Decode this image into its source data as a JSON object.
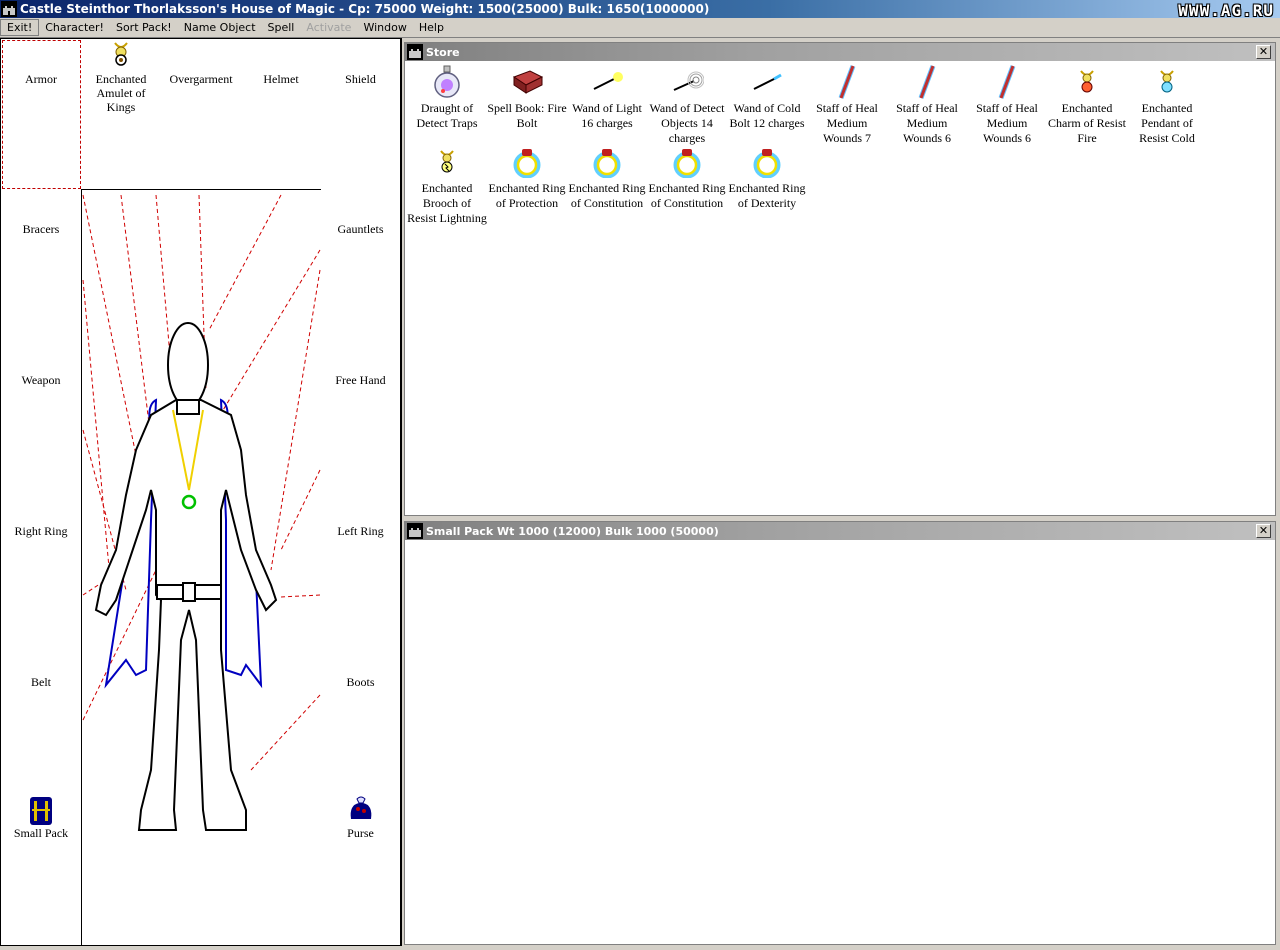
{
  "window": {
    "title": "Castle Steinthor Thorlaksson's House of Magic - Cp: 75000 Weight: 1500(25000) Bulk: 1650(1000000)",
    "watermark": "WWW.AG.RU",
    "app_icon": "castle-icon"
  },
  "menu": {
    "items": [
      "Exit!",
      "Character!",
      "Sort Pack!",
      "Name Object",
      "Spell",
      "Activate",
      "Window",
      "Help"
    ],
    "active_index": 0,
    "disabled_index": 5
  },
  "equipment": {
    "armor": "Armor",
    "amulet": "Enchanted Amulet of Kings",
    "overgarment": "Overgarment",
    "helmet": "Helmet",
    "shield": "Shield",
    "bracers": "Bracers",
    "gauntlets": "Gauntlets",
    "weapon": "Weapon",
    "free_hand": "Free Hand",
    "right_ring": "Right Ring",
    "left_ring": "Left Ring",
    "belt": "Belt",
    "boots": "Boots",
    "small_pack": "Small Pack",
    "purse": "Purse"
  },
  "store": {
    "title": "Store",
    "close": "✕",
    "items": [
      {
        "label": "Draught of Detect Traps",
        "icon": "potion-icon"
      },
      {
        "label": "Spell Book: Fire Bolt",
        "icon": "spellbook-icon"
      },
      {
        "label": "Wand of Light 16 charges",
        "icon": "wand-light-icon"
      },
      {
        "label": "Wand of Detect Objects 14 charges",
        "icon": "wand-detect-icon"
      },
      {
        "label": "Wand of Cold Bolt 12 charges",
        "icon": "wand-cold-icon"
      },
      {
        "label": "Staff of Heal Medium Wounds 7",
        "icon": "staff-icon"
      },
      {
        "label": "Staff of Heal Medium Wounds 6",
        "icon": "staff-icon"
      },
      {
        "label": "Staff of Heal Medium Wounds 6",
        "icon": "staff-icon"
      },
      {
        "label": "Enchanted Charm of Resist Fire",
        "icon": "charm-icon"
      },
      {
        "label": "Enchanted Pendant of Resist Cold",
        "icon": "pendant-icon"
      },
      {
        "label": "Enchanted Brooch of Resist Lightning",
        "icon": "brooch-icon"
      },
      {
        "label": "Enchanted Ring of Protection",
        "icon": "ring-icon"
      },
      {
        "label": "Enchanted Ring of Constitution",
        "icon": "ring-icon"
      },
      {
        "label": "Enchanted Ring of Constitution",
        "icon": "ring-icon"
      },
      {
        "label": "Enchanted Ring of Dexterity",
        "icon": "ring-icon"
      }
    ]
  },
  "pack": {
    "title": "Small Pack Wt 1000 (12000) Bulk 1000 (50000)",
    "close": "✕"
  }
}
